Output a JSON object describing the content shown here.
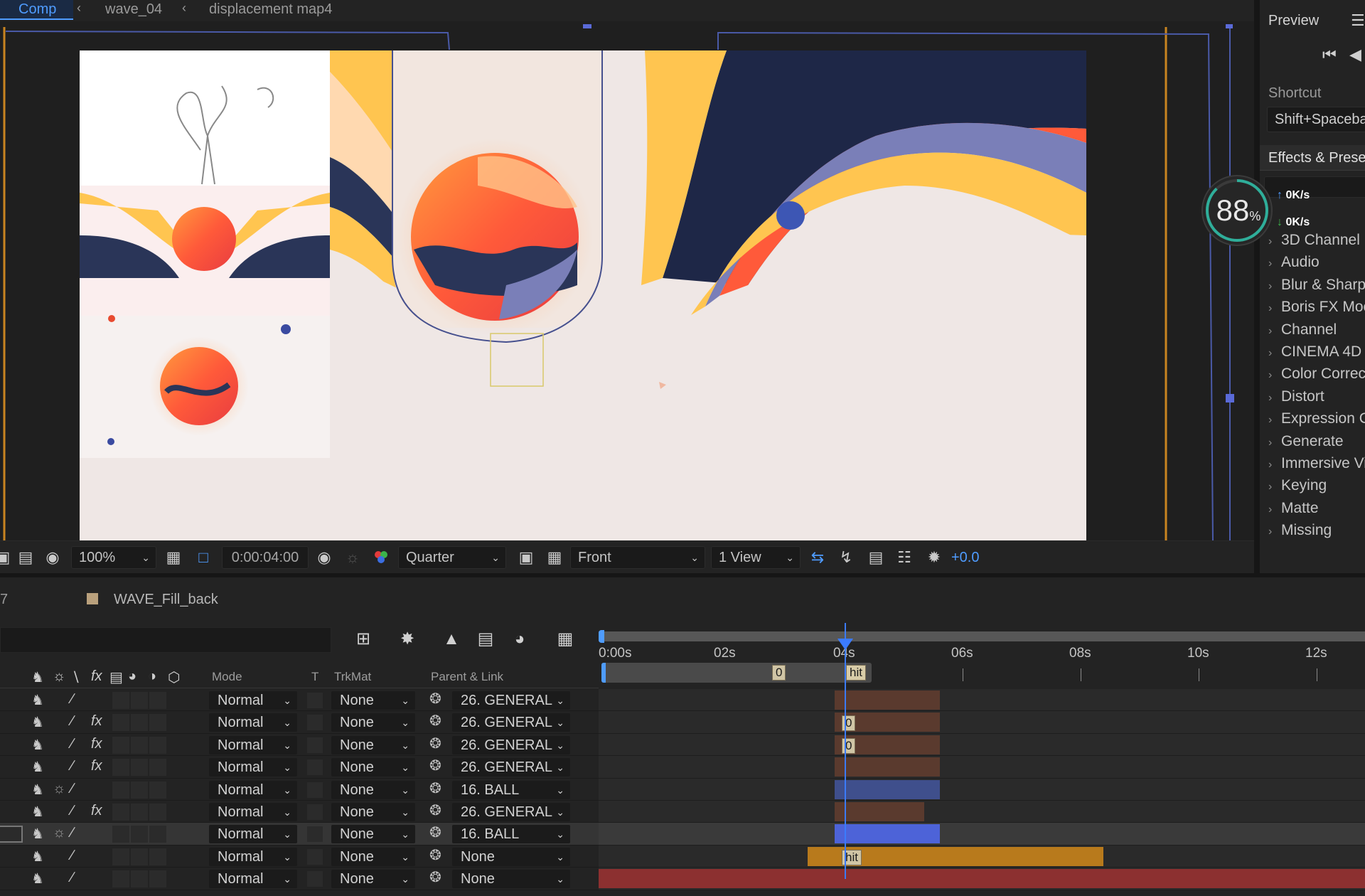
{
  "breadcrumbs": [
    "Comp",
    "wave_04",
    "displacement map4"
  ],
  "viewer_toolbar": {
    "zoom": "100%",
    "timecode": "0:00:04:00",
    "resolution": "Quarter",
    "camera": "Front",
    "views": "1 View",
    "exposure": "+0.0"
  },
  "right_panel": {
    "preview_title": "Preview",
    "shortcut_label": "Shortcut",
    "shortcut_value": "Shift+Spacebar",
    "effects_tab": "Effects & Presets",
    "effects_categories": [
      "3D Channel",
      "Audio",
      "Blur & Sharpen",
      "Boris FX Mocha",
      "Channel",
      "CINEMA 4D",
      "Color Correction",
      "Distort",
      "Expression Controls",
      "Generate",
      "Immersive Video",
      "Keying",
      "Matte",
      "Missing"
    ]
  },
  "perf_widget": {
    "percent": "88",
    "unit": "%",
    "up_rate": "0",
    "down_rate": "0",
    "rate_unit": "K/s"
  },
  "timeline": {
    "comp_index": "7",
    "comp_name": "WAVE_Fill_back",
    "columns": {
      "mode": "Mode",
      "t": "T",
      "trkmat": "TrkMat",
      "parent": "Parent & Link"
    },
    "ruler_labels": [
      "0:00s",
      "02s",
      "04s",
      "06s",
      "08s",
      "10s",
      "12s"
    ],
    "marker_labels": [
      "0",
      "hit"
    ],
    "layers": [
      {
        "fx": false,
        "star": false,
        "mode": "Normal",
        "trkmat": "None",
        "parent": "26. GENERAL",
        "marker": "",
        "clip_color": "#5a3a2e",
        "selected": false
      },
      {
        "fx": true,
        "star": false,
        "mode": "Normal",
        "trkmat": "None",
        "parent": "26. GENERAL",
        "marker": "0",
        "clip_color": "#5a3a2e",
        "selected": false
      },
      {
        "fx": true,
        "star": false,
        "mode": "Normal",
        "trkmat": "None",
        "parent": "26. GENERAL",
        "marker": "0",
        "clip_color": "#5a3a2e",
        "selected": false
      },
      {
        "fx": true,
        "star": false,
        "mode": "Normal",
        "trkmat": "None",
        "parent": "26. GENERAL",
        "marker": "",
        "clip_color": "#5a3a2e",
        "selected": false
      },
      {
        "fx": false,
        "star": true,
        "mode": "Normal",
        "trkmat": "None",
        "parent": "16. BALL",
        "marker": "",
        "clip_color": "#3f4f8c",
        "selected": false
      },
      {
        "fx": true,
        "star": false,
        "mode": "Normal",
        "trkmat": "None",
        "parent": "26. GENERAL",
        "marker": "",
        "clip_color": "#5a3a2e",
        "selected": false
      },
      {
        "fx": false,
        "star": true,
        "mode": "Normal",
        "trkmat": "None",
        "parent": "16. BALL",
        "marker": "",
        "clip_color": "#4d63d8",
        "selected": true
      },
      {
        "fx": false,
        "star": false,
        "mode": "Normal",
        "trkmat": "None",
        "parent": "None",
        "marker": "hit",
        "clip_color": "#b87a1c",
        "selected": false
      },
      {
        "fx": false,
        "star": false,
        "mode": "Normal",
        "trkmat": "None",
        "parent": "None",
        "marker": "",
        "clip_color": "#8c3030",
        "selected": false
      }
    ]
  },
  "colors": {
    "accent": "#4f9cff",
    "panel": "#232323",
    "playhead": "#3b7bff"
  },
  "icons": [
    "monitor-icon",
    "mask-icon",
    "region-icon",
    "transparency-grid-icon",
    "camera-icon",
    "color-channels-icon",
    "fast-preview-icon",
    "flowchart-icon",
    "graph-editor-icon",
    "motion-blur-icon",
    "draft-3d-icon",
    "shy-icon",
    "frame-blend-icon",
    "skip-back-icon",
    "menu-icon"
  ]
}
